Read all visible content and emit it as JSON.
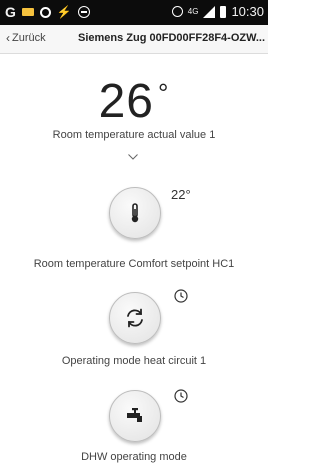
{
  "statusbar": {
    "carrier_glyph": "G",
    "network": "4G",
    "time": "10:30",
    "icons": [
      "google-icon",
      "mail-icon",
      "chat-icon",
      "flash-icon",
      "dnd-icon",
      "alarm-icon",
      "signal-icon",
      "battery-icon"
    ]
  },
  "navbar": {
    "back_label": "Zurück",
    "title": "Siemens Zug 00FD00FF28F4-OZW..."
  },
  "main": {
    "room_temp_value": "26",
    "room_temp_unit": "°",
    "room_temp_label": "Room temperature actual value 1",
    "comfort_setpoint_value": "22°",
    "comfort_setpoint_label": "Room temperature Comfort setpoint HC1",
    "operating_mode_label": "Operating mode heat circuit 1",
    "dhw_mode_label": "DHW operating mode"
  },
  "colors": {
    "statusbar_bg": "#0c0c0c",
    "navbar_bg": "#f7f7f7",
    "accent_mail": "#f6c23e",
    "flash_red": "#ff3b30"
  }
}
